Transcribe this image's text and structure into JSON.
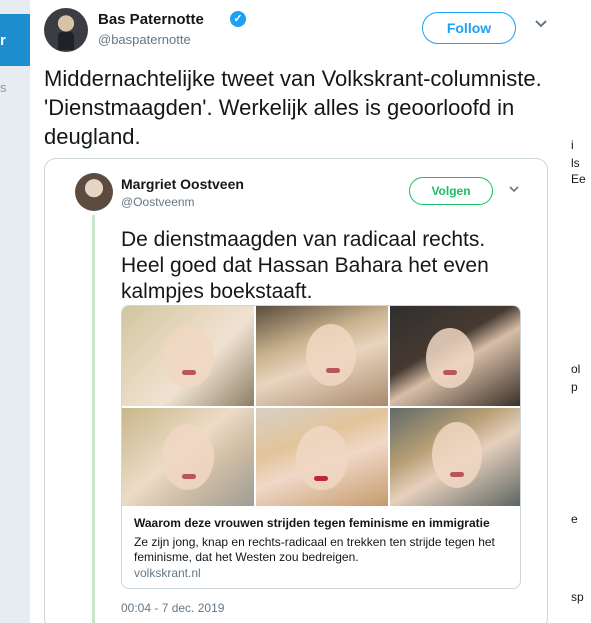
{
  "background": {
    "left_fragment_top": "r",
    "left_fragment_bottom": "s",
    "right_fragments": [
      "i",
      "ls",
      "Ee",
      "ol",
      "p",
      "e",
      "sp"
    ]
  },
  "tweet": {
    "author_name": "Bas Paternotte",
    "author_handle": "@baspaternotte",
    "verified_icon": "✓",
    "follow_label": "Follow",
    "menu_icon": "chevron-down",
    "text": "Middernachtelijke tweet van Volkskrant-columniste. 'Dienstmaagden'. Werkelijk alles is geoorloofd in deugland."
  },
  "quoted": {
    "author_name": "Margriet Oostveen",
    "author_handle": "@Oostveenm",
    "follow_label": "Volgen",
    "text": "De dienstmaagden van radicaal rechts. Heel goed dat Hassan Bahara het even kalmpjes boekstaaft.",
    "link_card": {
      "title": "Waarom deze vrouwen strijden tegen feminisme en immigratie",
      "description": "Ze zijn jong, knap en rechts-radicaal en trekken ten strijde tegen het feminisme, dat het Westen zou bedreigen.",
      "domain": "volkskrant.nl"
    },
    "timestamp": "00:04 - 7 dec. 2019"
  },
  "colors": {
    "accent": "#1da1f2",
    "volgen_green": "#17bf63",
    "thread_line": "#c9e6c9"
  }
}
